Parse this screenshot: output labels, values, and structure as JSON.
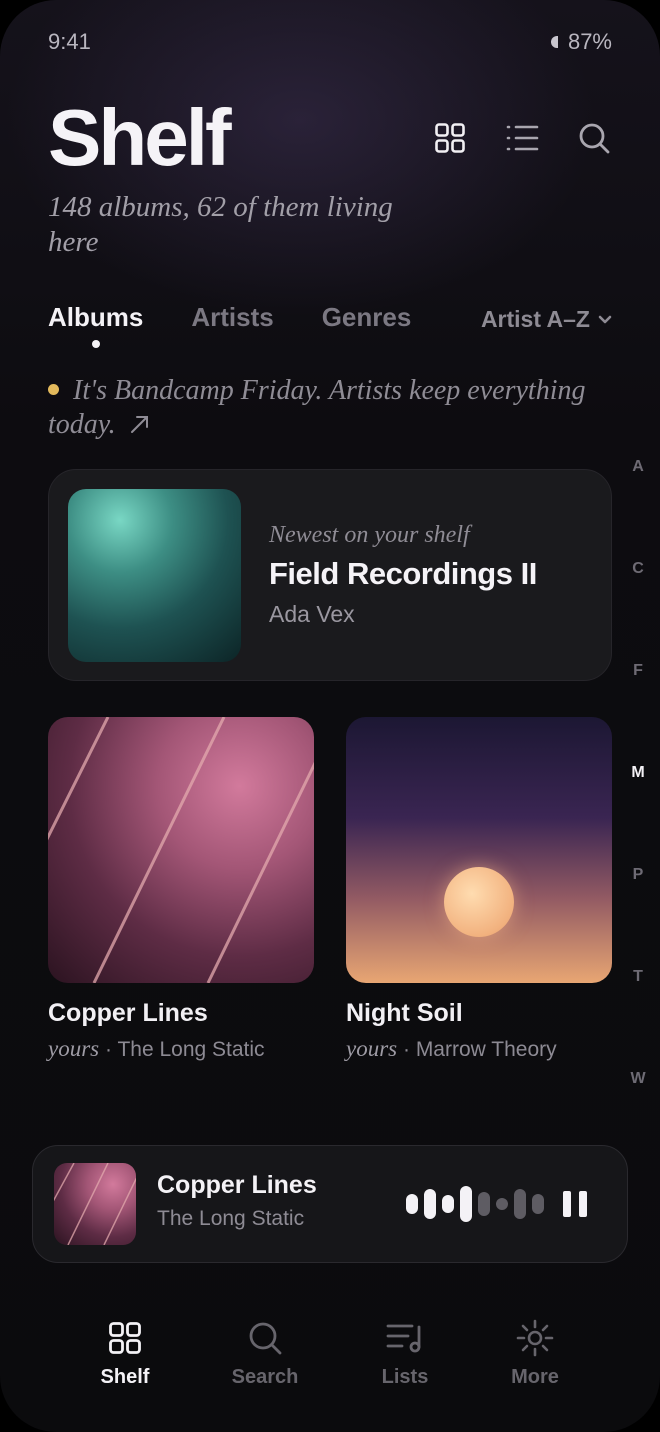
{
  "status": {
    "time": "9:41",
    "battery": "87%"
  },
  "header": {
    "title": "Shelf",
    "subtitle": "148 albums, 62 of them living here",
    "icons": [
      "grid-view-icon",
      "list-view-icon",
      "search-icon"
    ]
  },
  "tabs": [
    {
      "label": "Albums",
      "active": true
    },
    {
      "label": "Artists",
      "active": false
    },
    {
      "label": "Genres",
      "active": false
    }
  ],
  "sort": {
    "label": "Artist A–Z",
    "icon": "chevron-down-icon"
  },
  "notice": {
    "text": "It's Bandcamp Friday. Artists keep everything today.",
    "icon": "arrow-up-right-icon",
    "dot_color": "#e3b95c"
  },
  "featured": {
    "eyebrow": "Newest on your shelf",
    "title": "Field Recordings II",
    "artist": "Ada Vex"
  },
  "albums": [
    {
      "title": "Copper Lines",
      "tag": "yours",
      "separator": "·",
      "artist": "The Long Static"
    },
    {
      "title": "Night Soil",
      "tag": "yours",
      "separator": "·",
      "artist": "Marrow Theory"
    }
  ],
  "az_index": {
    "letters": [
      "A",
      "C",
      "F",
      "M",
      "P",
      "T",
      "W"
    ],
    "active": "M"
  },
  "now_playing": {
    "title": "Copper Lines",
    "artist": "The Long Static",
    "state": "playing",
    "control_icon": "pause-icon"
  },
  "tabbar": [
    {
      "label": "Shelf",
      "icon": "grid-icon",
      "active": true
    },
    {
      "label": "Search",
      "icon": "search-icon",
      "active": false
    },
    {
      "label": "Lists",
      "icon": "playlist-icon",
      "active": false
    },
    {
      "label": "More",
      "icon": "gear-icon",
      "active": false
    }
  ],
  "colors": {
    "background": "#0b0b0d",
    "card": "#1a1a1d",
    "accent_dot": "#e3b95c",
    "text": "#f4f2f6",
    "muted": "#8e8b94"
  }
}
